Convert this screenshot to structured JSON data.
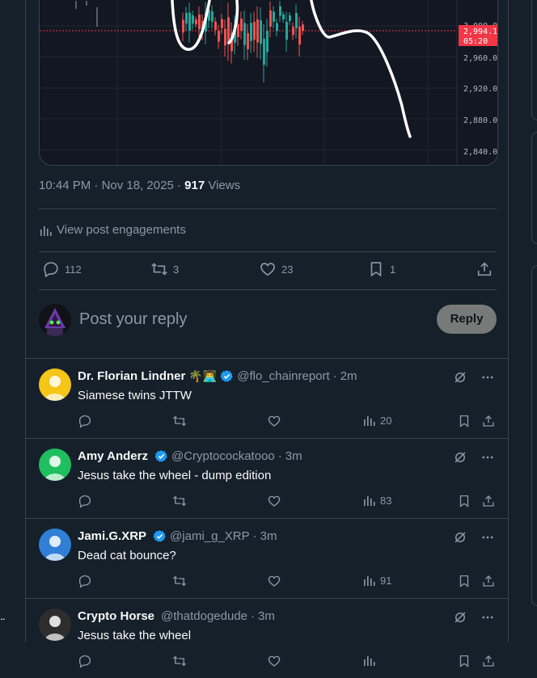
{
  "chart": {
    "price_labels": [
      "3,000.00",
      "2,960.00",
      "2,920.00",
      "2,880.00",
      "2,840.00"
    ],
    "current_price": "2,994.11",
    "current_timer": "05:20",
    "price_tag_color": "#f23645"
  },
  "post": {
    "time": "10:44 PM",
    "date": "Nov 18, 2025",
    "views_count": "917",
    "views_label": "Views",
    "engagements_label": "View post engagements",
    "replies": "112",
    "reposts": "3",
    "likes": "23",
    "bookmarks": "1"
  },
  "composer": {
    "placeholder": "Post your reply",
    "reply_button": "Reply"
  },
  "replies": [
    {
      "name": "Dr. Florian Lindner",
      "emoji": "🌴👨‍💻",
      "handle": "@flo_chainreport",
      "time": "2m",
      "text": "Siamese twins JTTW",
      "views": "20",
      "verified": true,
      "avatar_color": "#f5c518"
    },
    {
      "name": "Amy Anderz",
      "emoji": "",
      "handle": "@Cryptocockatooo",
      "time": "3m",
      "text": "Jesus take the wheel - dump edition",
      "views": "83",
      "verified": true,
      "avatar_color": "#1fbf5f"
    },
    {
      "name": "Jami.G.XRP",
      "emoji": "",
      "handle": "@jami_g_XRP",
      "time": "3m",
      "text": "Dead cat bounce?",
      "views": "91",
      "verified": true,
      "avatar_color": "#2f7fd6"
    },
    {
      "name": "Crypto Horse",
      "emoji": "",
      "handle": "@thatdogedude",
      "time": "3m",
      "text": "Jesus take the wheel",
      "views": "",
      "verified": false,
      "avatar_color": "#2d2d2d"
    }
  ],
  "colors": {
    "background": "#15202b",
    "border": "#38444d",
    "muted": "#8b98a5",
    "verified": "#1d9bf0"
  },
  "left_dots": ".."
}
